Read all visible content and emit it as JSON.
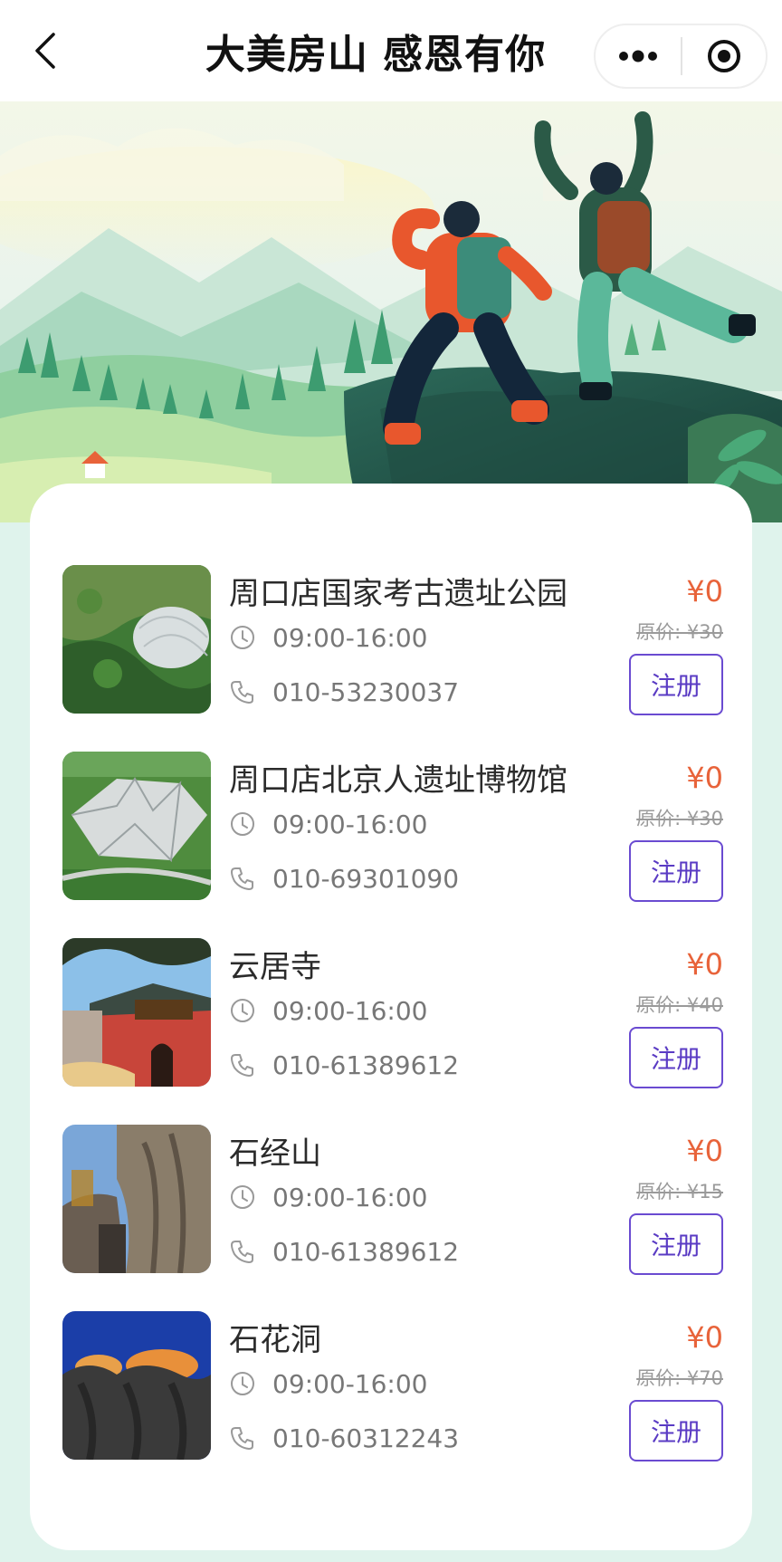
{
  "navbar": {
    "title": "大美房山 感恩有你",
    "back_icon": "chevron-left-icon",
    "more_icon": "more-dots-icon",
    "target_icon": "target-icon"
  },
  "banner": {
    "illustration": "hikers-on-mountain-illustration",
    "colors": {
      "sky": "#eef7ef",
      "hill": "#7dc8a0",
      "jacket": "#e8572d",
      "teal": "#3c9c8a"
    }
  },
  "venues": [
    {
      "name": "周口店国家考古遗址公园",
      "hours": "09:00-16:00",
      "phone": "010-53230037",
      "price": "¥0",
      "original_price": "原价: ¥30",
      "register_label": "注册",
      "thumbnail": "archaeological-park-thumbnail"
    },
    {
      "name": "周口店北京人遗址博物馆",
      "hours": "09:00-16:00",
      "phone": "010-69301090",
      "price": "¥0",
      "original_price": "原价: ¥30",
      "register_label": "注册",
      "thumbnail": "museum-building-thumbnail"
    },
    {
      "name": "云居寺",
      "hours": "09:00-16:00",
      "phone": "010-61389612",
      "price": "¥0",
      "original_price": "原价: ¥40",
      "register_label": "注册",
      "thumbnail": "temple-gate-thumbnail"
    },
    {
      "name": "石经山",
      "hours": "09:00-16:00",
      "phone": "010-61389612",
      "price": "¥0",
      "original_price": "原价: ¥15",
      "register_label": "注册",
      "thumbnail": "stone-mountain-thumbnail"
    },
    {
      "name": "石花洞",
      "hours": "09:00-16:00",
      "phone": "010-60312243",
      "price": "¥0",
      "original_price": "原价: ¥70",
      "register_label": "注册",
      "thumbnail": "cave-thumbnail"
    }
  ],
  "colors": {
    "accent": "#6a4bd1",
    "price": "#e8633a",
    "page_bg": "#dff3ec"
  },
  "icons": {
    "hours": "clock-icon",
    "phone": "phone-icon"
  }
}
